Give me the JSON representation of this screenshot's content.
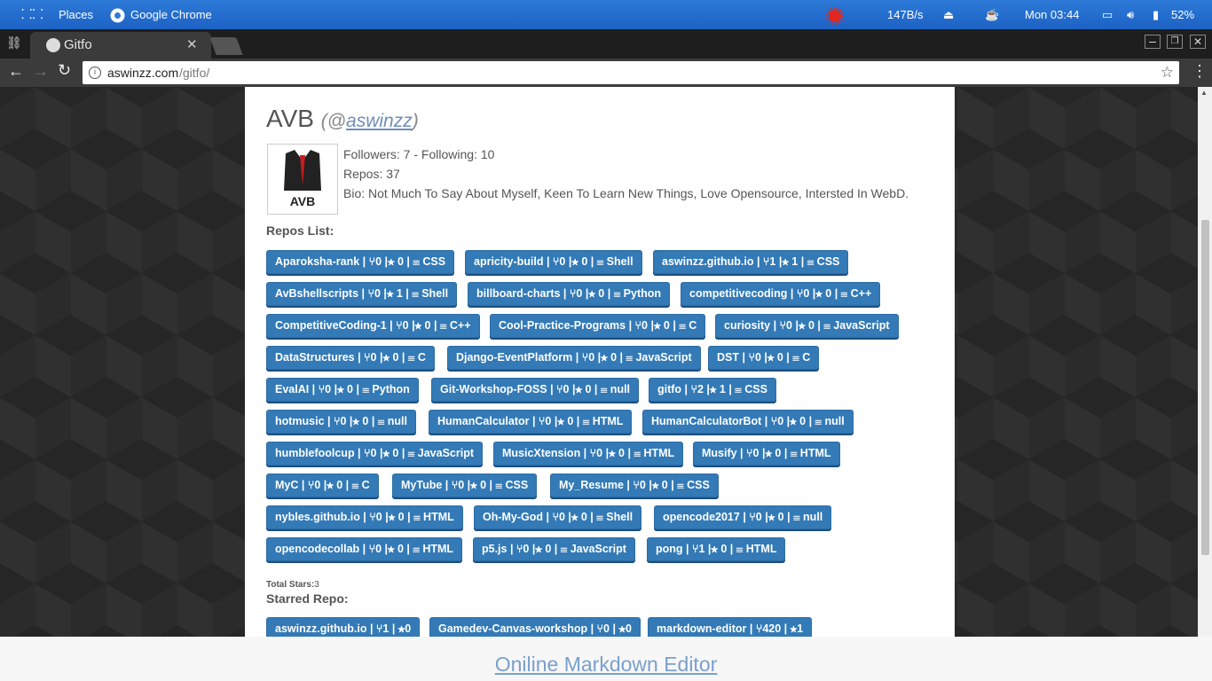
{
  "system_bar": {
    "places": "Places",
    "app": "Google Chrome",
    "net": "147B/s",
    "clock": "Mon 03:44",
    "battery": "52%"
  },
  "browser": {
    "tab_title": "Gitfo",
    "url_host": "aswinzz.com",
    "url_path": "/gitfo/"
  },
  "profile": {
    "name": "AVB",
    "handle_open": "(@",
    "handle": "aswinzz",
    "handle_close": ")",
    "avatar_text": "AVB",
    "followers": "Followers: 7 - Following: 10",
    "repos": "Repos: 37",
    "bio": "Bio: Not Much To Say About Myself, Keen To Learn New Things, Love Opensource, Intersted In WebD."
  },
  "repos_heading": "Repos List:",
  "repos": [
    "Aparoksha-rank | ⑂0 |★ 0 |  ☰ CSS",
    "apricity-build | ⑂0 |★ 0 |  ☰ Shell",
    "aswinzz.github.io | ⑂1 |★ 1 |  ☰ CSS",
    "AvBshellscripts | ⑂0 |★ 1 |  ☰ Shell",
    "billboard-charts | ⑂0 |★ 0 |  ☰ Python",
    "competitivecoding | ⑂0 |★ 0 |  ☰ C++",
    "CompetitiveCoding-1 | ⑂0 |★ 0 |  ☰ C++",
    "Cool-Practice-Programs | ⑂0 |★ 0 |  ☰ C",
    "curiosity | ⑂0 |★ 0 |  ☰ JavaScript",
    "DataStructures | ⑂0 |★ 0 |  ☰ C",
    "Django-EventPlatform | ⑂0 |★ 0 |  ☰ JavaScript",
    "DST | ⑂0 |★ 0 |  ☰ C",
    "EvalAI | ⑂0 |★ 0 |  ☰ Python",
    "Git-Workshop-FOSS | ⑂0 |★ 0 |  ☰ null",
    "gitfo | ⑂2 |★ 1 |  ☰ CSS",
    "hotmusic | ⑂0 |★ 0 |  ☰ null",
    "HumanCalculator | ⑂0 |★ 0 |  ☰ HTML",
    "HumanCalculatorBot | ⑂0 |★ 0 |  ☰ null",
    "humblefoolcup | ⑂0 |★ 0 |  ☰ JavaScript",
    "MusicXtension | ⑂0 |★ 0 |  ☰ HTML",
    "Musify | ⑂0 |★ 0 |  ☰ HTML",
    "MyC | ⑂0 |★ 0 |  ☰ C",
    "MyTube | ⑂0 |★ 0 |  ☰ CSS",
    "My_Resume | ⑂0 |★ 0 |  ☰ CSS",
    "nybles.github.io | ⑂0 |★ 0 |  ☰ HTML",
    "Oh-My-God | ⑂0 |★ 0 |  ☰ Shell",
    "opencode2017 | ⑂0 |★ 0 |  ☰ null",
    "opencodecollab | ⑂0 |★ 0 |  ☰ HTML",
    "p5.js | ⑂0 |★ 0 |  ☰ JavaScript",
    "pong | ⑂1 |★ 0 |  ☰ HTML"
  ],
  "total_stars_label": "Total Stars:",
  "total_stars": "3",
  "starred_heading": "Starred Repo:",
  "starred": [
    "aswinzz.github.io | ⑂1 |  ★0",
    "Gamedev-Canvas-workshop | ⑂0 |  ★0",
    "markdown-editor | ⑂420 |  ★1"
  ],
  "footer_link": "Oniline Markdown Editor"
}
